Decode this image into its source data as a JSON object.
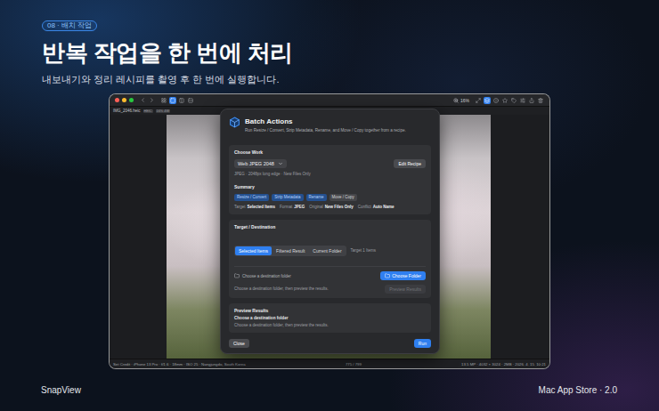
{
  "badge": "08 · 배치 작업",
  "headline": "반복 작업을 한 번에 처리",
  "subtitle": "내보내기와 정리 레시피를 촬영 후 한 번에 실행합니다.",
  "footer": {
    "app": "SnapView",
    "store": "Mac App Store · 2.0"
  },
  "window": {
    "toolbar": {
      "view_modes": [
        {
          "selected": false
        },
        {
          "selected": true
        },
        {
          "selected": false
        },
        {
          "selected": false
        }
      ],
      "zoom": "16%",
      "tools": [
        {
          "selected": false
        },
        {
          "selected": true
        },
        {
          "selected": false
        },
        {
          "selected": false
        },
        {
          "selected": false
        },
        {
          "selected": false
        },
        {
          "selected": false
        },
        {
          "selected": false
        }
      ]
    },
    "file": {
      "name": "IMG_2046.heic",
      "badges": [
        "HEIC",
        "16% 4W"
      ]
    },
    "status_bar": {
      "left": "Set Credit · iPhone 13 Pro · f/1.6 · 18mm · ISO 25 · Nangjungdo, South Korea",
      "center": "775 / 799",
      "right": "13.5 MP · 4032 × 3024 · 2MB · 2026. 4. 15. 10:21"
    }
  },
  "dialog": {
    "title": "Batch Actions",
    "description": "Run Resize / Convert, Strip Metadata, Rename, and Move / Copy together from a recipe.",
    "choose_work": {
      "heading": "Choose Work",
      "recipe": "Web JPEG 2048",
      "edit_button": "Edit Recipe",
      "caption": "JPEG · 2048px long edge · New Files Only"
    },
    "summary": {
      "heading": "Summary",
      "steps": [
        {
          "label": "Resize / Convert",
          "on": true
        },
        {
          "label": "Strip Metadata",
          "on": true
        },
        {
          "label": "Rename",
          "on": true
        },
        {
          "label": "Move / Copy",
          "on": false
        }
      ],
      "facts": [
        {
          "label": "Target",
          "value": "Selected Items"
        },
        {
          "label": "Format",
          "value": "JPEG"
        },
        {
          "label": "Original",
          "value": "New Files Only"
        },
        {
          "label": "Conflict",
          "value": "Auto Name"
        }
      ]
    },
    "target": {
      "heading": "Target / Destination",
      "tabs": [
        {
          "label": "Selected Items",
          "selected": true
        },
        {
          "label": "Filtered Result",
          "selected": false
        },
        {
          "label": "Current Folder",
          "selected": false
        }
      ],
      "count": "Target 1 Items",
      "folder_placeholder": "Choose a destination folder",
      "choose_button": "Choose Folder",
      "hint": "Choose a destination folder, then preview the results.",
      "preview_button": {
        "label": "Preview Results",
        "disabled": true
      }
    },
    "preview": {
      "heading": "Preview Results",
      "title": "Choose a destination folder",
      "text": "Choose a destination folder, then preview the results."
    },
    "close_button": "Close",
    "run_button": "Run"
  }
}
